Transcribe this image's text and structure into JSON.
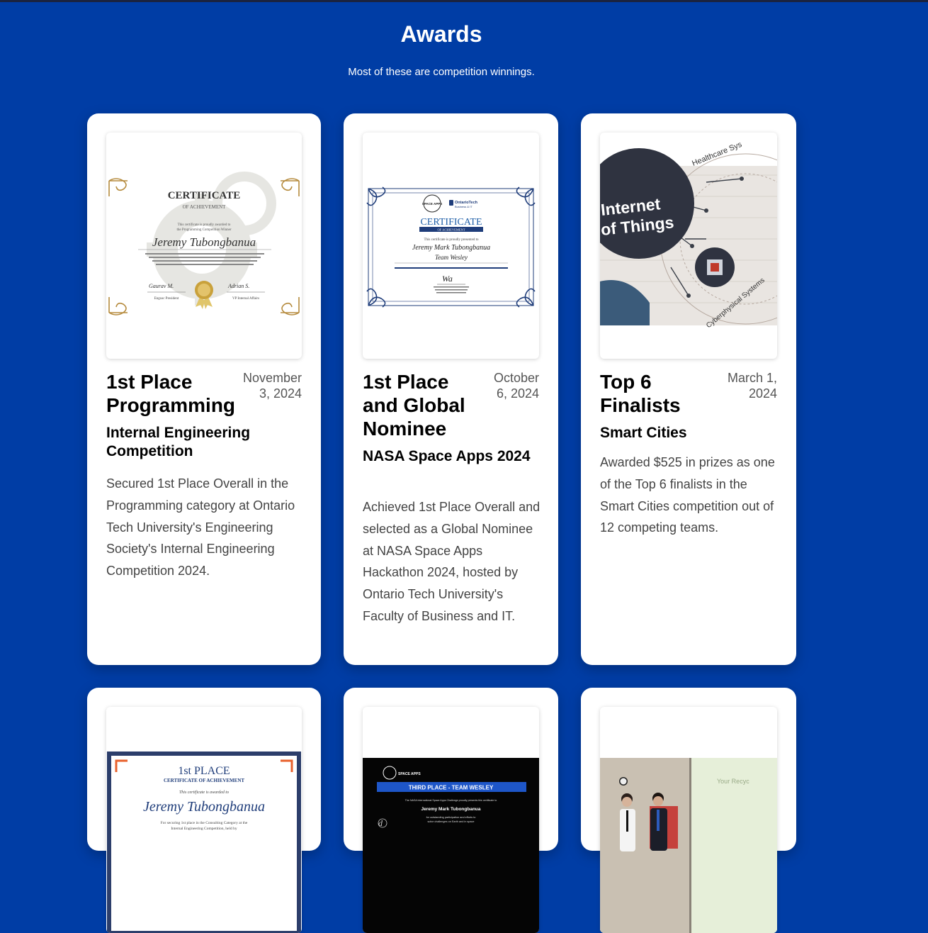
{
  "header": {
    "title": "Awards",
    "subtitle": "Most of these are competition winnings."
  },
  "awards": [
    {
      "title": "1st Place Programming",
      "date": "November 3, 2024",
      "org": "Internal Engineering Competition",
      "description": "Secured 1st Place Overall in the Programming category at Ontario Tech University's Engineering Society's Internal Engineering Competition 2024.",
      "image": {
        "heading": "CERTIFICATE",
        "subheading": "OF ACHIEVEMENT",
        "line1": "This certificate is proudly awarded to",
        "line2": "the Programming Competition Winner",
        "name": "Jeremy Tubongbanua",
        "sig_left": "Engsoc President",
        "sig_right": "VP Internal Affairs"
      }
    },
    {
      "title": "1st Place and Global Nominee",
      "date": "October 6, 2024",
      "org": "NASA Space Apps 2024",
      "description": "Achieved 1st Place Overall and selected as a Global Nominee at NASA Space Apps Hackathon 2024, hosted by Ontario Tech University's Faculty of Business and IT.",
      "image": {
        "badge": "SPACE APPS",
        "brand": "OntarioTech",
        "brand_sub": "Business & IT",
        "heading": "CERTIFICATE",
        "subheading": "OF ACHIEVEMENT",
        "line1": "This certificate is proudly presented to",
        "name": "Jeremy Mark Tubongbanua",
        "team": "Team Wesley"
      }
    },
    {
      "title": "Top 6 Finalists",
      "date": "March 1, 2024",
      "org": "Smart Cities",
      "description": "Awarded $525 in prizes as one of the Top 6 finalists in the Smart Cities competition out of 12 competing teams.",
      "image": {
        "text1": "Internet",
        "text2": "of Things",
        "text3": "Cyberphysical Systems",
        "text4": "Healthcare Sys"
      }
    },
    {
      "image": {
        "heading": "1st PLACE",
        "subheading": "CERTIFICATE OF ACHIEVEMENT",
        "line1": "This certificate is awarded to",
        "name": "Jeremy Tubongbanua",
        "line2": "For securing 1st place in the Consulting Category at the",
        "line3": "Internal Engineering Competition, held by"
      }
    },
    {
      "image": {
        "badge": "SPACE APPS",
        "banner": "THIRD PLACE - TEAM WESLEY",
        "line1": "The NASA International Space Apps Challenge proudly presents this certificate to",
        "name": "Jeremy Mark Tubongbanua",
        "line2": "for outstanding participation and efforts to",
        "line3": "solve challenges on Earth and in space"
      }
    },
    {
      "image": {
        "screen_text": "Your Recyc"
      }
    }
  ],
  "colors": {
    "background": "#003da5",
    "card": "#ffffff",
    "title": "#000000",
    "date": "#555555",
    "description": "#444444",
    "certificate_blue": "#1f3d7a",
    "certificate_gold": "#b58a3c",
    "certificate_orange": "#e8612c"
  }
}
